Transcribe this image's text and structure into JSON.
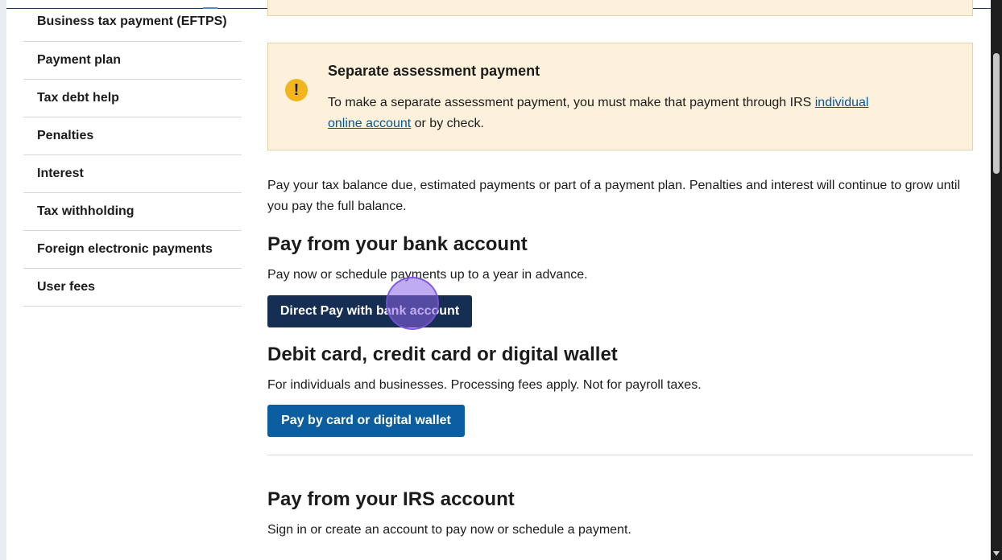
{
  "sidebar": {
    "items": [
      {
        "label": "Business tax payment (EFTPS)"
      },
      {
        "label": "Payment plan"
      },
      {
        "label": "Tax debt help"
      },
      {
        "label": "Penalties"
      },
      {
        "label": "Interest"
      },
      {
        "label": "Tax withholding"
      },
      {
        "label": "Foreign electronic payments"
      },
      {
        "label": "User fees"
      }
    ]
  },
  "alert": {
    "icon": "exclamation-circle-icon",
    "icon_glyph": "!",
    "title": "Separate assessment payment",
    "body_before": "To make a separate assessment payment, you must make that payment through IRS ",
    "link_text_1": "individual",
    "link_text_2": "online account",
    "body_after": " or by check."
  },
  "main": {
    "intro": "Pay your tax balance due, estimated payments or part of a payment plan. Penalties and interest will continue to grow until you pay the full balance.",
    "bank": {
      "heading": "Pay from your bank account",
      "subtext": "Pay now or schedule payments up to a year in advance.",
      "button": "Direct Pay with bank account"
    },
    "card": {
      "heading": "Debit card, credit card or digital wallet",
      "subtext": "For individuals and businesses. Processing fees apply. Not for payroll taxes.",
      "button": "Pay by card or digital wallet"
    },
    "irs": {
      "heading": "Pay from your IRS account",
      "subtext": "Sign in or create an account to pay now or schedule a payment."
    }
  },
  "colors": {
    "alert_bg": "#fdf1dc",
    "primary_dark": "#162e51",
    "primary": "#0b5ea0",
    "link": "#00599c",
    "warning_icon": "#f2b51e"
  }
}
